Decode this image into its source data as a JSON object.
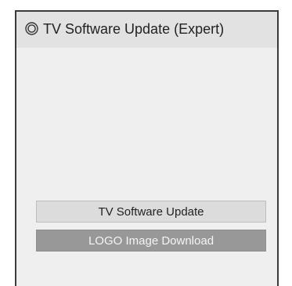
{
  "window": {
    "title": "TV Software Update (Expert)",
    "title_icon": "power-circle-icon"
  },
  "menu": {
    "items": [
      {
        "label": "TV Software Update",
        "state": "normal"
      },
      {
        "label": "LOGO Image Download",
        "state": "highlighted"
      }
    ]
  },
  "colors": {
    "panel_background": "#efefef",
    "title_bar_background": "#e2e2e2",
    "button_normal": "#dcdcdc",
    "button_highlighted": "#989898",
    "border": "#3b3b3b"
  }
}
